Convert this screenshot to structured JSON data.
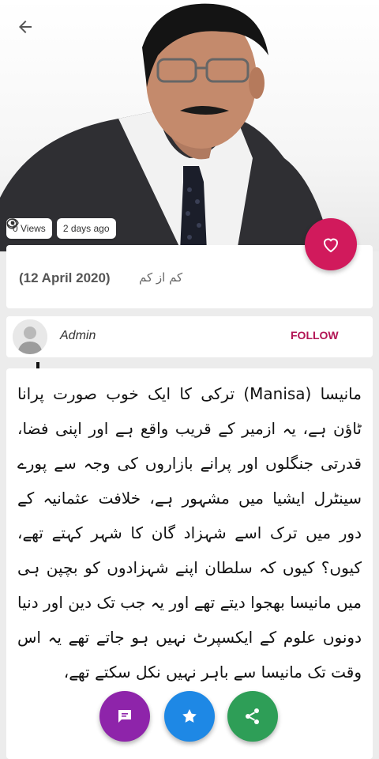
{
  "colors": {
    "accent_pink": "#d11a5c",
    "follow_text": "#b21454",
    "fab_chat": "#8e24aa",
    "fab_star": "#1e88e5",
    "fab_share": "#2e9e57"
  },
  "header": {
    "back_icon": "arrow-left-icon",
    "stats": {
      "views_icon": "eye-icon",
      "views_label": "0 Views",
      "time_icon": "clock-icon",
      "time_label": "2 days ago"
    },
    "favorite_icon": "heart-outline-icon"
  },
  "title": {
    "urdu": "کم از کم",
    "date": "(12 April 2020)"
  },
  "author": {
    "name": "Admin",
    "follow_label": "FOLLOW"
  },
  "article": {
    "body": "مانیسا (Manisa) ترکی کا ایک خوب صورت پرانا ٹاؤن ہے، یہ ازمیر کے قریب واقع ہے اور اپنی فضا، قدرتی جنگلوں اور پرانے بازاروں کی وجہ سے پورے سینٹرل ایشیا میں مشہور ہے، خلافت عثمانیہ کے دور میں ترک اسے شہزاد گان کا شہر کہتے تھے، کیوں؟ کیوں کہ سلطان اپنے شہزادوں کو بچپن ہی میں مانیسا بھجوا دیتے تھے اور یہ جب تک دین اور دنیا دونوں علوم کے ایکسپرٹ نہیں ہو جاتے تھے یہ اس وقت تک مانیسا سے باہر نہیں نکل سکتے تھے،"
  },
  "fabs": {
    "chat_icon": "chat-icon",
    "star_icon": "star-icon",
    "share_icon": "share-icon"
  }
}
